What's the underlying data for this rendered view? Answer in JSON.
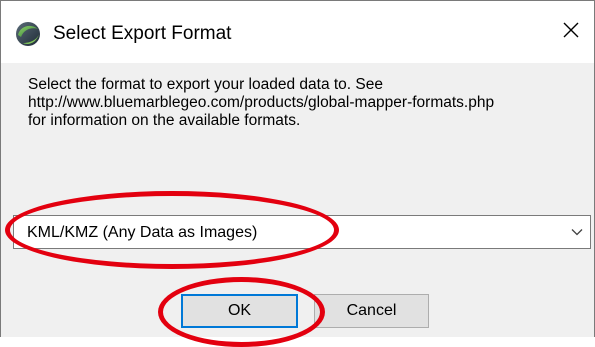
{
  "window": {
    "title": "Select Export Format",
    "close_icon": "close-icon",
    "app_icon": "global-mapper-globe-icon"
  },
  "message": {
    "line1": "Select the format to export your loaded data to. See",
    "line2": "http://www.bluemarblegeo.com/products/global-mapper-formats.php",
    "line3": "for information on the available formats."
  },
  "format_select": {
    "selected": "KML/KMZ (Any Data as Images)",
    "arrow_icon": "chevron-down-icon"
  },
  "buttons": {
    "ok": "OK",
    "cancel": "Cancel"
  },
  "annotations": {
    "highlight_color": "#e3000f",
    "highlighted_items": [
      "format-select",
      "ok-button"
    ]
  },
  "colors": {
    "dialog_bg": "#f0f0f0",
    "titlebar_bg": "#ffffff",
    "focus_blue": "#0078d7",
    "button_bg": "#e1e1e1"
  }
}
